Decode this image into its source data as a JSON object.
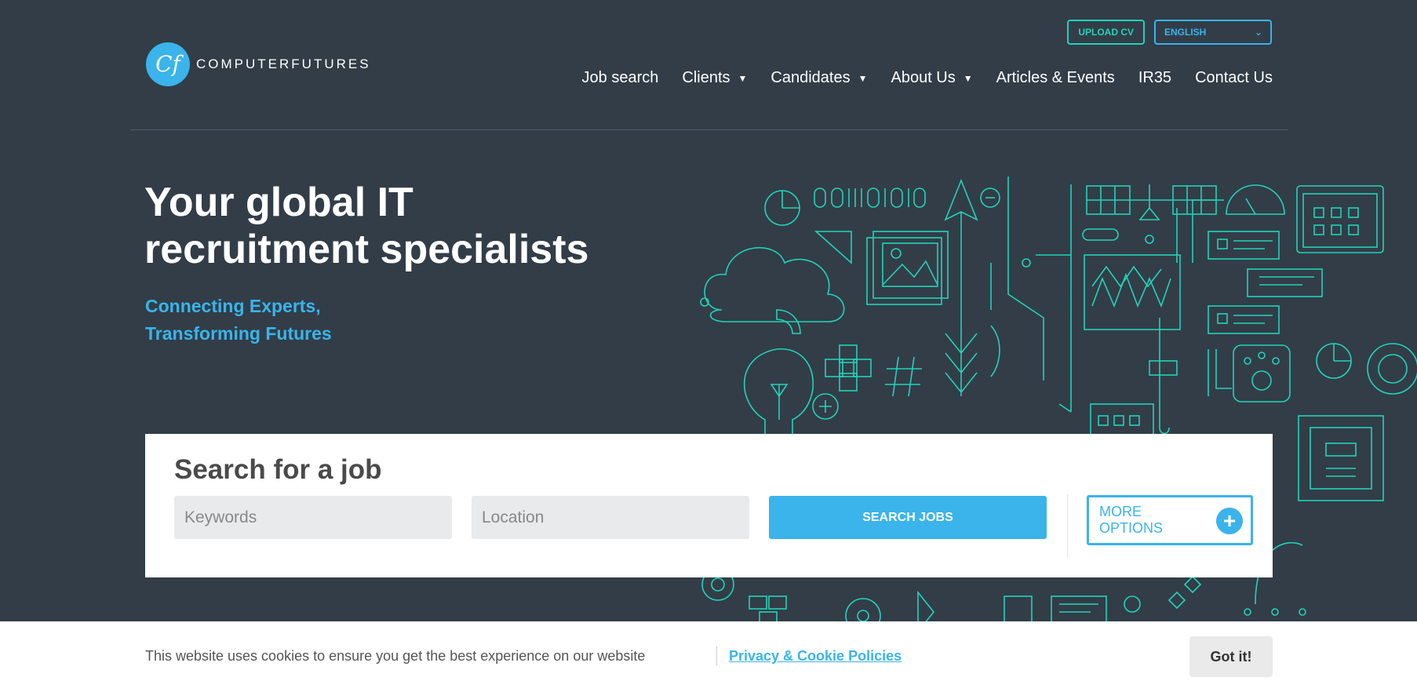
{
  "header": {
    "upload_label": "UPLOAD CV",
    "language": "ENGLISH",
    "logo_mark": "Cf",
    "logo_text": "COMPUTERFUTURES"
  },
  "nav": [
    {
      "label": "Job search",
      "dropdown": false
    },
    {
      "label": "Clients",
      "dropdown": true
    },
    {
      "label": "Candidates",
      "dropdown": true
    },
    {
      "label": "About Us",
      "dropdown": true
    },
    {
      "label": "Articles & Events",
      "dropdown": false
    },
    {
      "label": "IR35",
      "dropdown": false
    },
    {
      "label": "Contact Us",
      "dropdown": false
    }
  ],
  "hero": {
    "title_line1": "Your global IT",
    "title_line2": "recruitment specialists",
    "sub_line1": "Connecting Experts,",
    "sub_line2": "Transforming Futures"
  },
  "search": {
    "title": "Search for a job",
    "keywords_placeholder": "Keywords",
    "location_placeholder": "Location",
    "submit_label": "SEARCH JOBS",
    "more_line1": "MORE",
    "more_line2": "OPTIONS"
  },
  "cookie": {
    "message": "This website uses cookies to ensure you get the best experience on our website",
    "link": "Privacy & Cookie Policies",
    "accept": "Got it!"
  },
  "colors": {
    "background": "#323d48",
    "accent_blue": "#3ab4ea",
    "accent_teal": "#22d3b8"
  }
}
